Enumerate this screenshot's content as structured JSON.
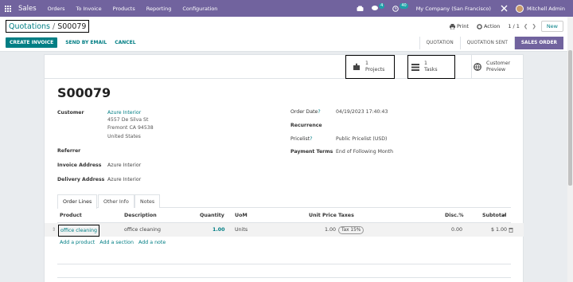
{
  "navbar": {
    "app_name": "Sales",
    "menu": [
      "Orders",
      "To Invoice",
      "Products",
      "Reporting",
      "Configuration"
    ],
    "chat_badge": "4",
    "activity_badge": "40",
    "company": "My Company (San Francisco)",
    "user": "Mitchell Admin"
  },
  "control": {
    "breadcrumb_parent": "Quotations",
    "breadcrumb_sep": "/",
    "breadcrumb_current": "S00079",
    "print": "Print",
    "action": "Action",
    "pager": "1 / 1",
    "new": "New",
    "buttons": {
      "create_invoice": "CREATE INVOICE",
      "send_email": "SEND BY EMAIL",
      "cancel": "CANCEL"
    },
    "stages": [
      "QUOTATION",
      "QUOTATION SENT",
      "SALES ORDER"
    ],
    "active_stage": "SALES ORDER"
  },
  "smart_buttons": {
    "projects_count": "1",
    "projects_label": "Projects",
    "tasks_count": "1",
    "tasks_label": "Tasks",
    "preview_line1": "Customer",
    "preview_line2": "Preview"
  },
  "record": {
    "name": "S00079",
    "customer_label": "Customer",
    "customer": "Azure Interior",
    "address": [
      "4557 De Silva St",
      "Fremont CA 94538",
      "United States"
    ],
    "referrer_label": "Referrer",
    "invoice_address_label": "Invoice Address",
    "invoice_address": "Azure Interior",
    "delivery_address_label": "Delivery Address",
    "delivery_address": "Azure Interior",
    "order_date_label": "Order Date",
    "order_date": "04/19/2023 17:40:43",
    "recurrence_label": "Recurrence",
    "pricelist_label": "Pricelist",
    "pricelist": "Public Pricelist (USD)",
    "payment_terms_label": "Payment Terms",
    "payment_terms": "End of Following Month"
  },
  "tabs": [
    "Order Lines",
    "Other Info",
    "Notes"
  ],
  "table": {
    "headers": {
      "product": "Product",
      "description": "Description",
      "quantity": "Quantity",
      "uom": "UoM",
      "unit_price": "Unit Price",
      "taxes": "Taxes",
      "disc": "Disc.%",
      "subtotal": "Subtotal"
    },
    "rows": [
      {
        "product": "office cleaning",
        "description": "office cleaning",
        "quantity": "1.00",
        "uom": "Units",
        "unit_price": "1.00",
        "taxes": "Tax 15%",
        "disc": "0.00",
        "subtotal": "$ 1.00"
      }
    ],
    "add_product": "Add a product",
    "add_section": "Add a section",
    "add_note": "Add a note"
  }
}
